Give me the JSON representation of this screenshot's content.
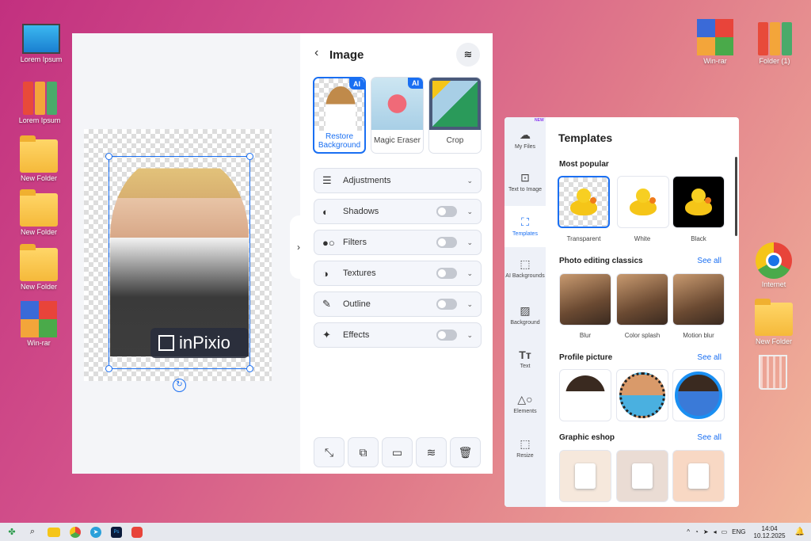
{
  "desktop": {
    "left": [
      "Lorem Ipsum",
      "Lorem Ipsum",
      "New Folder",
      "New Folder",
      "New Folder",
      "Win-rar"
    ],
    "right": [
      "Win-rar",
      "Folder (1)",
      "Internet",
      "New Folder"
    ]
  },
  "editor": {
    "title": "Image",
    "brand": "inPixio",
    "tools": [
      {
        "label": "Restore Background",
        "badge": "AI"
      },
      {
        "label": "Magic Eraser",
        "badge": "AI"
      },
      {
        "label": "Crop"
      }
    ],
    "rows": [
      {
        "label": "Adjustments",
        "icon": "sliders-icon",
        "toggle": false
      },
      {
        "label": "Shadows",
        "icon": "shadows-icon",
        "toggle": true,
        "on": false
      },
      {
        "label": "Filters",
        "icon": "filters-icon",
        "toggle": true,
        "on": false
      },
      {
        "label": "Textures",
        "icon": "textures-icon",
        "toggle": true,
        "on": false
      },
      {
        "label": "Outline",
        "icon": "outline-icon",
        "toggle": true,
        "on": false
      },
      {
        "label": "Effects",
        "icon": "effects-icon",
        "toggle": true,
        "on": false
      }
    ]
  },
  "templates": {
    "title": "Templates",
    "new_badge": "NEW",
    "sidebar": [
      "My Files",
      "Text to Image",
      "Templates",
      "AI Backgrounds",
      "Background",
      "Text",
      "Elements",
      "Resize"
    ],
    "see_all": "See all",
    "sections": [
      {
        "title": "Most popular",
        "items": [
          "Transparent",
          "White",
          "Black"
        ]
      },
      {
        "title": "Photo editing classics",
        "items": [
          "Blur",
          "Color splash",
          "Motion blur"
        ]
      },
      {
        "title": "Profile picture"
      },
      {
        "title": "Graphic eshop"
      }
    ]
  },
  "taskbar": {
    "lang": "ENG",
    "time": "14:04",
    "date": "10.12.2025"
  },
  "colors": {
    "accent": "#1a6ff2"
  }
}
